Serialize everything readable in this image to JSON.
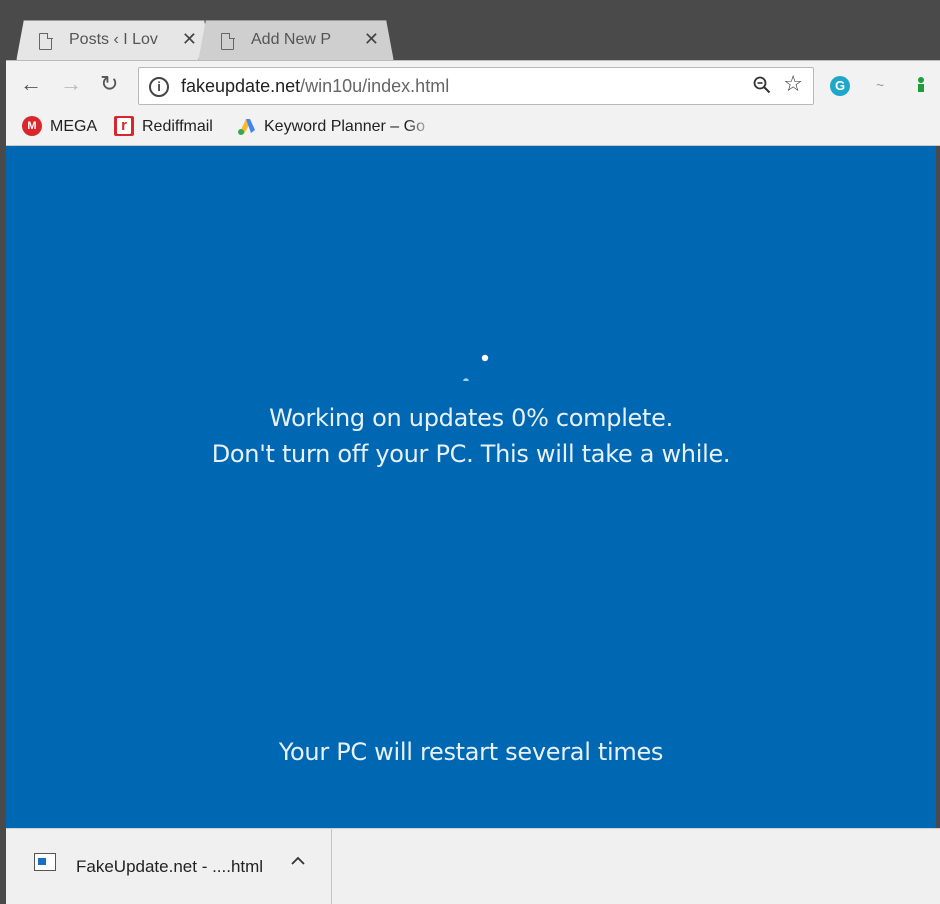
{
  "tabs": [
    {
      "label": "Posts ‹ I Lov",
      "close": "✕"
    },
    {
      "label": "Add New P",
      "close": "✕"
    }
  ],
  "nav": {
    "back": "←",
    "forward": "→",
    "reload": "↻"
  },
  "omnibox": {
    "info": "i",
    "domain": "fakeupdate.net",
    "path": "/win10u/index.html",
    "star": "☆"
  },
  "extensions": {
    "grammarly": "G",
    "ext2": "~"
  },
  "bookmarks": [
    {
      "label": "MEGA",
      "icon": "mega-icon",
      "icon_text": "M"
    },
    {
      "label": "Rediffmail",
      "icon": "rediffmail-icon",
      "icon_text": "r"
    },
    {
      "label": "Keyword Planner – Go",
      "icon": "google-ads-icon"
    }
  ],
  "update_screen": {
    "line1": "Working on updates  0% complete.",
    "line2": "Don't turn off your PC. This will take a while.",
    "line3": "Your PC will restart several times",
    "background": "#0067b2"
  },
  "download": {
    "filename": "FakeUpdate.net - ....html"
  }
}
